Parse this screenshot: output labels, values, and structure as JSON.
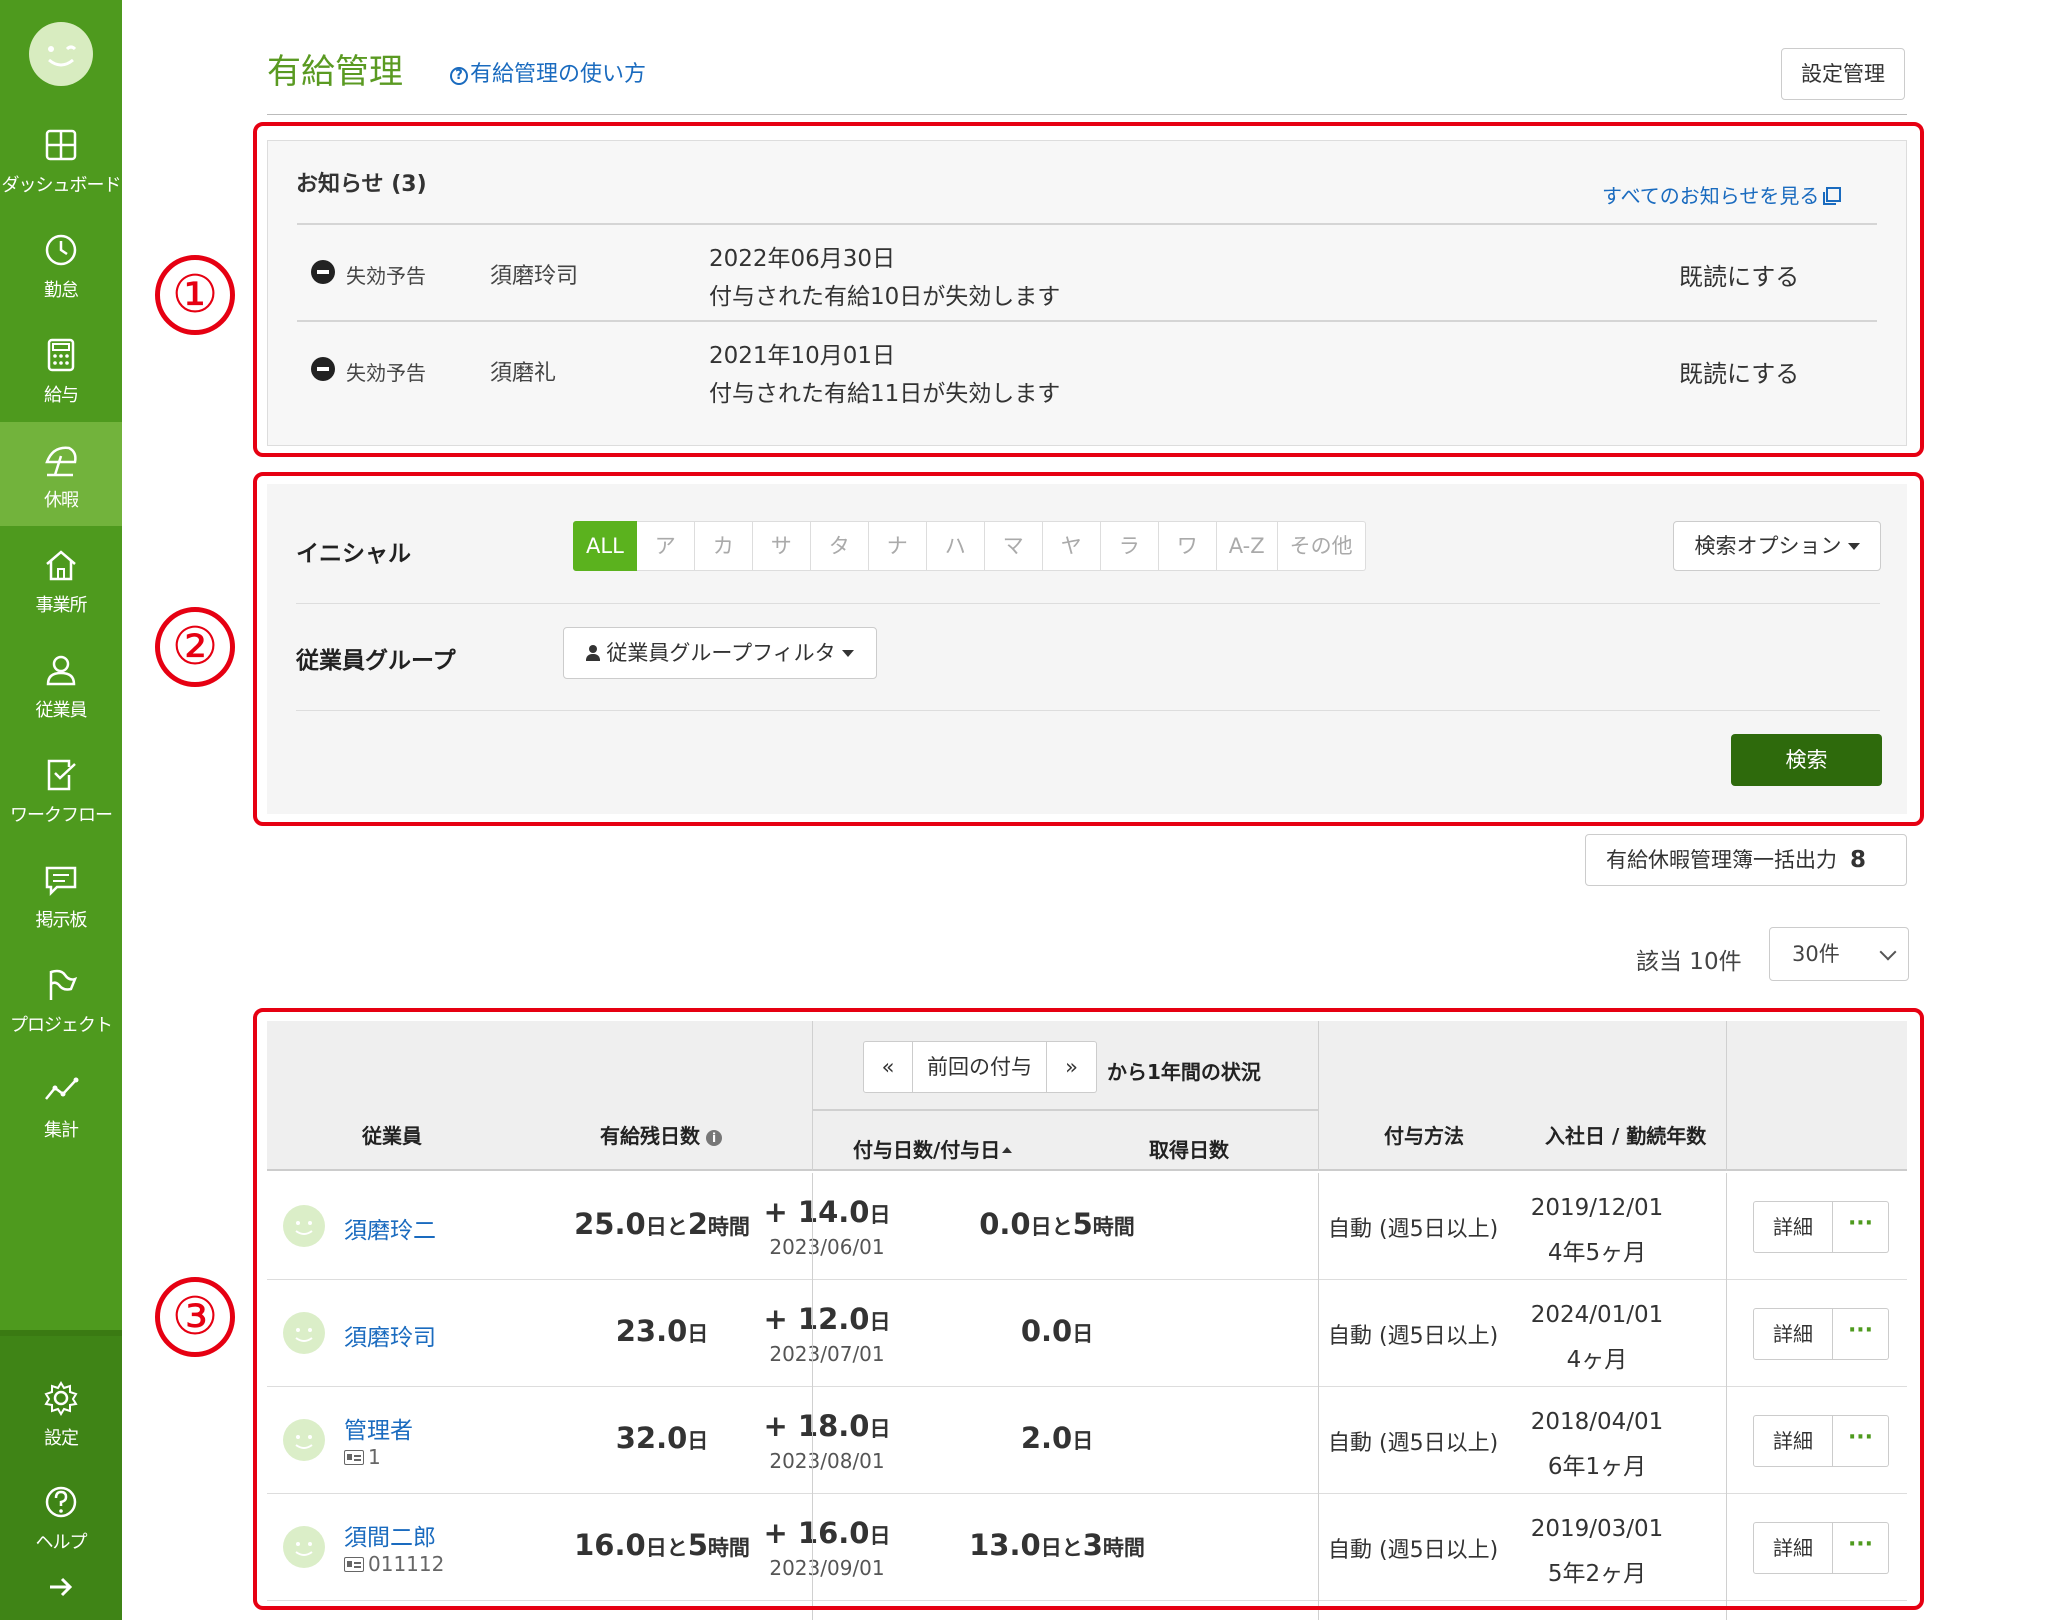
{
  "sidebar": {
    "items": [
      {
        "label": "ダッシュボード",
        "icon": "grid-icon"
      },
      {
        "label": "勤怠",
        "icon": "clock-icon"
      },
      {
        "label": "給与",
        "icon": "calculator-icon"
      },
      {
        "label": "休暇",
        "icon": "umbrella-icon"
      },
      {
        "label": "事業所",
        "icon": "home-icon"
      },
      {
        "label": "従業員",
        "icon": "person-icon"
      },
      {
        "label": "ワークフロー",
        "icon": "check-doc-icon"
      },
      {
        "label": "掲示板",
        "icon": "chat-icon"
      },
      {
        "label": "プロジェクト",
        "icon": "flag-icon"
      },
      {
        "label": "集計",
        "icon": "line-chart-icon"
      }
    ],
    "bottom": [
      {
        "label": "設定",
        "icon": "gear-icon"
      },
      {
        "label": "ヘルプ",
        "icon": "help-icon"
      }
    ],
    "expand_icon": "arrow-right-icon"
  },
  "header": {
    "title": "有給管理",
    "help_link": "有給管理の使い方",
    "settings_button": "設定管理"
  },
  "annotations": [
    "①",
    "②",
    "③"
  ],
  "notices": {
    "title": "お知らせ (3)",
    "view_all": "すべてのお知らせを見る",
    "items": [
      {
        "tag": "失効予告",
        "employee": "須磨玲司",
        "date": "2022年06月30日",
        "message": "付与された有給10日が失効します",
        "action": "既読にする"
      },
      {
        "tag": "失効予告",
        "employee": "須磨礼",
        "date": "2021年10月01日",
        "message": "付与された有給11日が失効します",
        "action": "既読にする"
      }
    ]
  },
  "search": {
    "initial_label": "イニシャル",
    "initials": [
      "ALL",
      "ア",
      "カ",
      "サ",
      "タ",
      "ナ",
      "ハ",
      "マ",
      "ヤ",
      "ラ",
      "ワ",
      "A-Z",
      "その他"
    ],
    "selected_initial": "ALL",
    "options_button": "検索オプション",
    "group_label": "従業員グループ",
    "group_filter": "従業員グループフィルタ",
    "search_button": "検索"
  },
  "export": {
    "label": "有給休暇管理簿一括出力",
    "count": "8"
  },
  "results": {
    "hits": "該当 10件",
    "per_page": "30件"
  },
  "table": {
    "headers": {
      "employee": "従業員",
      "remaining": "有給残日数",
      "prev": "«",
      "period": "前回の付与",
      "next": "»",
      "period_suffix": "から1年間の状況",
      "granted": "付与日数/付与日",
      "taken": "取得日数",
      "method": "付与方法",
      "joined": "入社日 / 勤続年数"
    },
    "rows": [
      {
        "name": "須磨玲二",
        "empno": "",
        "remaining_num": "25.0",
        "remaining_unit": "日と",
        "remaining_hours": "2",
        "remaining_hunit": "時間",
        "grant_num": "+ 14.0",
        "grant_unit": "日",
        "grant_date": "2023/06/01",
        "taken_num": "0.0",
        "taken_unit": "日と",
        "taken_hours": "5",
        "taken_hunit": "時間",
        "method": "自動 (週5日以上)",
        "joined": "2019/12/01",
        "tenure": "4年5ヶ月",
        "detail": "詳細",
        "more": "···"
      },
      {
        "name": "須磨玲司",
        "empno": "",
        "remaining_num": "23.0",
        "remaining_unit": "日",
        "remaining_hours": "",
        "remaining_hunit": "",
        "grant_num": "+ 12.0",
        "grant_unit": "日",
        "grant_date": "2023/07/01",
        "taken_num": "0.0",
        "taken_unit": "日",
        "taken_hours": "",
        "taken_hunit": "",
        "method": "自動 (週5日以上)",
        "joined": "2024/01/01",
        "tenure": "4ヶ月",
        "detail": "詳細",
        "more": "···"
      },
      {
        "name": "管理者",
        "empno": "1",
        "remaining_num": "32.0",
        "remaining_unit": "日",
        "remaining_hours": "",
        "remaining_hunit": "",
        "grant_num": "+ 18.0",
        "grant_unit": "日",
        "grant_date": "2023/08/01",
        "taken_num": "2.0",
        "taken_unit": "日",
        "taken_hours": "",
        "taken_hunit": "",
        "method": "自動 (週5日以上)",
        "joined": "2018/04/01",
        "tenure": "6年1ヶ月",
        "detail": "詳細",
        "more": "···"
      },
      {
        "name": "須間二郎",
        "empno": "011112",
        "remaining_num": "16.0",
        "remaining_unit": "日と",
        "remaining_hours": "5",
        "remaining_hunit": "時間",
        "grant_num": "+ 16.0",
        "grant_unit": "日",
        "grant_date": "2023/09/01",
        "taken_num": "13.0",
        "taken_unit": "日と",
        "taken_hours": "3",
        "taken_hunit": "時間",
        "method": "自動 (週5日以上)",
        "joined": "2019/03/01",
        "tenure": "5年2ヶ月",
        "detail": "詳細",
        "more": "···"
      }
    ]
  },
  "colors": {
    "sidebar": "#4e9a1e",
    "accent": "#5bb21e",
    "link": "#1a6bbf",
    "annotation": "#e60012",
    "search_button": "#2e6a0c"
  }
}
